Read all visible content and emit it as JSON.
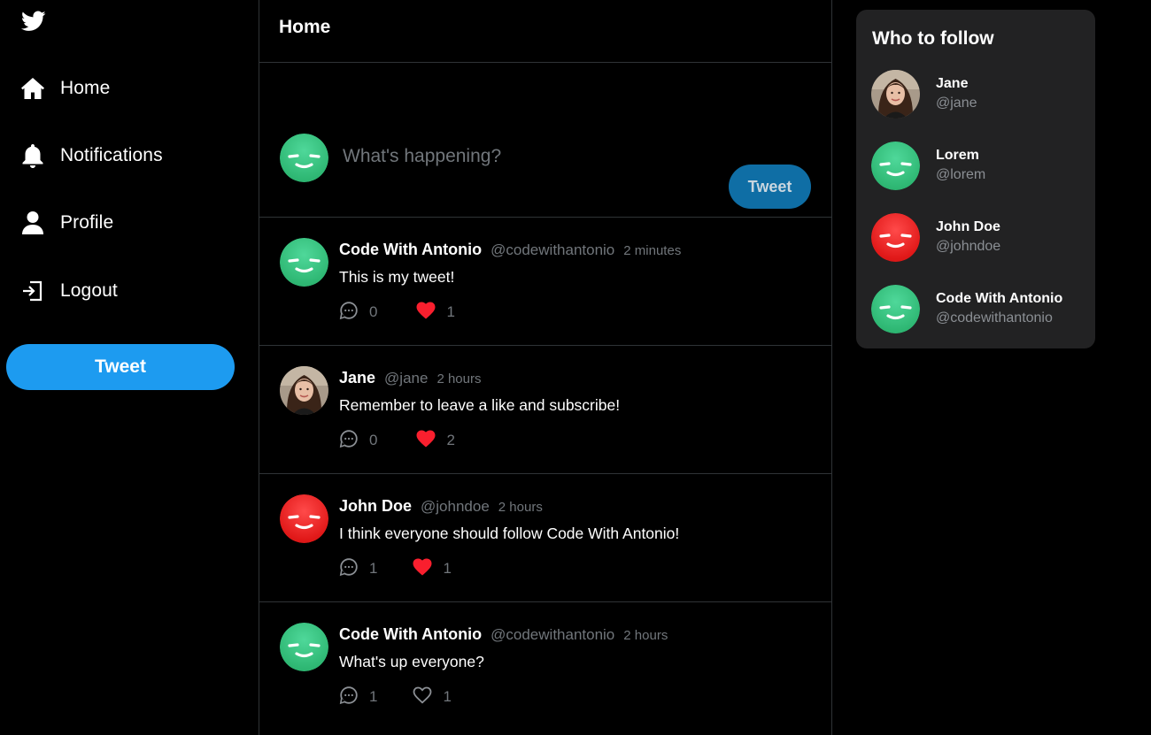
{
  "sidebar": {
    "logo_icon": "twitter-bird-icon",
    "items": [
      {
        "label": "Home",
        "icon": "home-icon"
      },
      {
        "label": "Notifications",
        "icon": "bell-icon"
      },
      {
        "label": "Profile",
        "icon": "user-icon"
      },
      {
        "label": "Logout",
        "icon": "logout-icon"
      }
    ],
    "tweet_label": "Tweet"
  },
  "main": {
    "title": "Home",
    "composer": {
      "placeholder": "What's happening?",
      "tweet_label": "Tweet"
    },
    "posts": [
      {
        "name": "Code With Antonio",
        "handle": "@codewithantonio",
        "time": "2 minutes",
        "body": "This is my tweet!",
        "comments": "0",
        "likes": "1",
        "liked": true,
        "avatar": "green"
      },
      {
        "name": "Jane",
        "handle": "@jane",
        "time": "2 hours",
        "body": "Remember to leave a like and subscribe!",
        "comments": "0",
        "likes": "2",
        "liked": true,
        "avatar": "photo"
      },
      {
        "name": "John Doe",
        "handle": "@johndoe",
        "time": "2 hours",
        "body": "I think everyone should follow Code With Antonio!",
        "comments": "1",
        "likes": "1",
        "liked": true,
        "avatar": "red"
      },
      {
        "name": "Code With Antonio",
        "handle": "@codewithantonio",
        "time": "2 hours",
        "body": "What's up everyone?",
        "comments": "1",
        "likes": "1",
        "liked": false,
        "avatar": "green"
      }
    ]
  },
  "who_to_follow": {
    "title": "Who to follow",
    "users": [
      {
        "name": "Jane",
        "handle": "@jane",
        "avatar": "photo"
      },
      {
        "name": "Lorem",
        "handle": "@lorem",
        "avatar": "green"
      },
      {
        "name": "John Doe",
        "handle": "@johndoe",
        "avatar": "red"
      },
      {
        "name": "Code With Antonio",
        "handle": "@codewithantonio",
        "avatar": "green"
      }
    ]
  },
  "colors": {
    "accent": "#1d9bf0",
    "like_red": "#f91f2e",
    "background": "#000000",
    "panel": "#222223",
    "muted_text": "#71767b"
  }
}
